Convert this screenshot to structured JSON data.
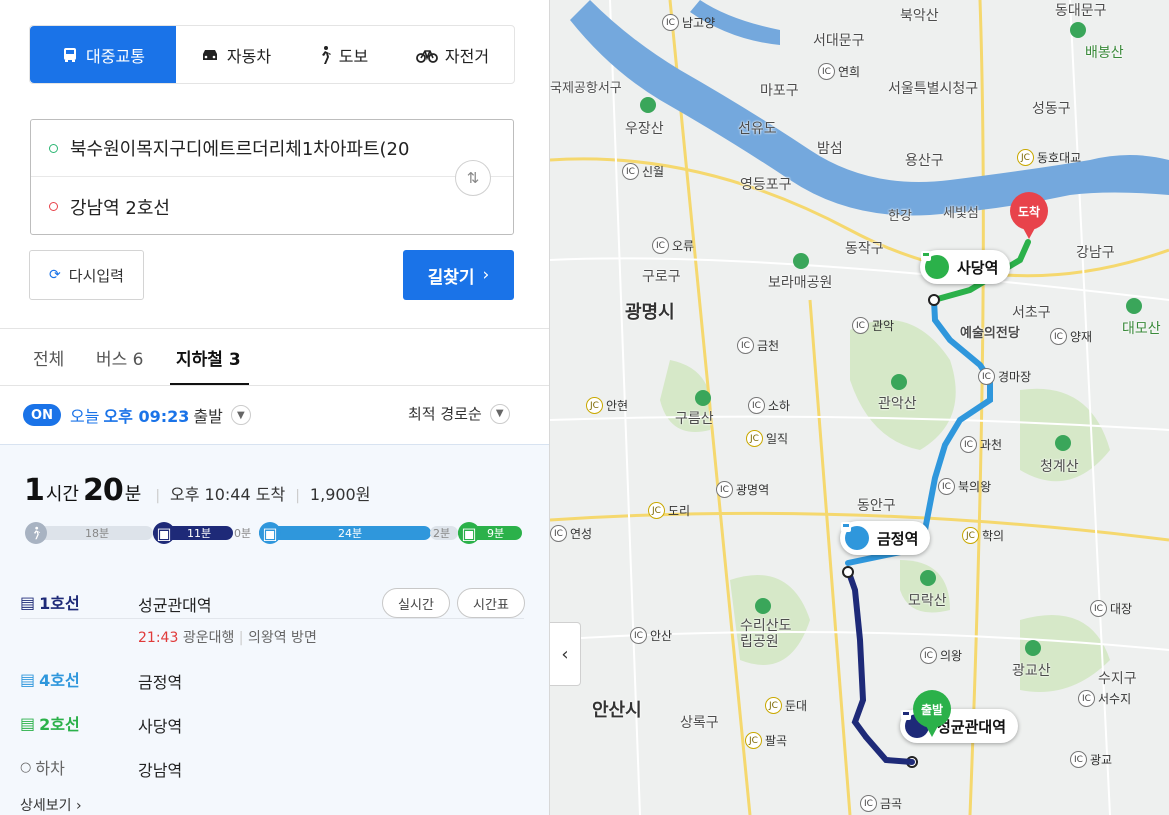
{
  "modes": [
    {
      "label": "대중교통",
      "icon": "bus-icon",
      "active": true
    },
    {
      "label": "자동차",
      "icon": "car-icon",
      "active": false
    },
    {
      "label": "도보",
      "icon": "walk-icon",
      "active": false
    },
    {
      "label": "자전거",
      "icon": "bicycle-icon",
      "active": false
    }
  ],
  "origin": "북수원이목지구디에트르더리체1차아파트(20",
  "destination": "강남역 2호선",
  "reset_label": "다시입력",
  "search_label": "길찾기",
  "result_tabs": [
    {
      "label": "전체",
      "active": false
    },
    {
      "label": "버스 6",
      "active": false
    },
    {
      "label": "지하철 3",
      "active": true
    }
  ],
  "departure": {
    "badge": "ON",
    "prefix": "오늘",
    "time": "오후 09:23",
    "suffix": "출발",
    "sort_label": "최적 경로순"
  },
  "route": {
    "hours": "1",
    "hours_unit": "시간",
    "minutes": "20",
    "minutes_unit": "분",
    "arrival": "오후 10:44 도착",
    "fare": "1,900원",
    "segments": [
      {
        "type": "walk",
        "label": "18분",
        "color": "#dde3ea"
      },
      {
        "type": "line1",
        "label": "11분",
        "color": "#1e2a78"
      },
      {
        "type": "walk",
        "label": "0분",
        "color": "#dde3ea"
      },
      {
        "type": "line4",
        "label": "24분",
        "color": "#2f97dc"
      },
      {
        "type": "walk",
        "label": "2분",
        "color": "#dde3ea"
      },
      {
        "type": "line2",
        "label": "9분",
        "color": "#2bb14a"
      }
    ],
    "steps": [
      {
        "line": "1호선",
        "station": "성균관대역",
        "color": "#1e2a78",
        "time": "21:43",
        "direction": "광운대행",
        "platform": "의왕역 방면",
        "realtime_label": "실시간",
        "timetable_label": "시간표"
      },
      {
        "line": "4호선",
        "station": "금정역",
        "color": "#2f97dc"
      },
      {
        "line": "2호선",
        "station": "사당역",
        "color": "#2bb14a"
      },
      {
        "line": "하차",
        "station": "강남역",
        "color": "#666666"
      }
    ],
    "detail_label": "상세보기"
  },
  "map": {
    "labels": [
      "서대문구",
      "마포구",
      "용산구",
      "동작구",
      "구로구",
      "광명시",
      "서초구",
      "강남구",
      "관악산",
      "구름산",
      "보라매공원",
      "청계산",
      "모락산",
      "수리산도립공원",
      "광교산",
      "동안구",
      "안산시",
      "상록구",
      "수지구",
      "성동구",
      "영등포구",
      "서울특별시청구",
      "우장산",
      "북악산",
      "동대문구",
      "배봉산",
      "예술의전당",
      "대모산",
      "국제공항서구",
      "한강",
      "세빛섬",
      "선유도",
      "밤섬"
    ],
    "ic_labels": [
      "남고양",
      "연희",
      "신월",
      "오류",
      "관악",
      "금천",
      "광명역",
      "도리",
      "소하",
      "일직",
      "안현",
      "연성",
      "안산",
      "둔대",
      "팔곡",
      "금곡",
      "의왕",
      "경마장",
      "과천",
      "북의왕",
      "학의",
      "대장",
      "서수지",
      "광교",
      "양재",
      "동호대교"
    ],
    "stations": [
      {
        "name": "사당역",
        "color": "#2bb14a"
      },
      {
        "name": "금정역",
        "color": "#2f97dc"
      },
      {
        "name": "성균관대역",
        "color": "#1e2a78"
      }
    ],
    "start_marker": "출발",
    "end_marker": "도착",
    "colors": {
      "line1": "#1e2a78",
      "line4": "#2f97dc",
      "line2": "#2bb14a",
      "river": "#74a8dd",
      "start": "#2bb14a",
      "end": "#e8434b"
    }
  }
}
